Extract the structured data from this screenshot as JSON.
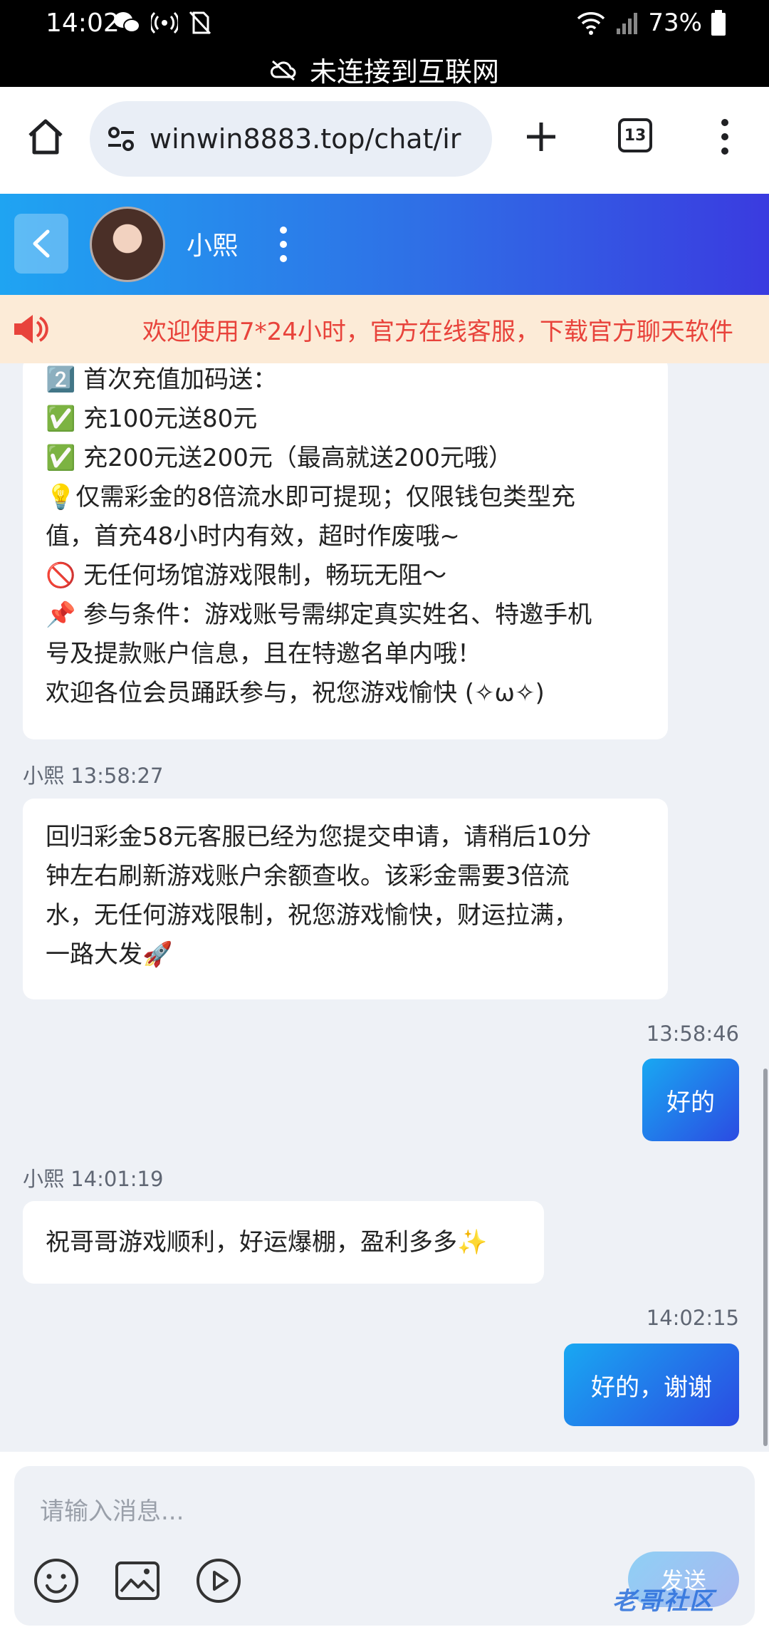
{
  "status_bar": {
    "time": "14:02",
    "battery": "73%",
    "offline_notice": "未连接到互联网"
  },
  "browser": {
    "url": "winwin8883.top/chat/ir",
    "tab_count": "13"
  },
  "chat_header": {
    "agent_name": "小熙"
  },
  "marquee": {
    "text": "欢迎使用7*24小时，官方在线客服，下载官方聊天软件"
  },
  "messages": [
    {
      "lines": [
        "2️⃣ 首次充值加码送：",
        "✅ 充100元送80元",
        "✅ 充200元送200元（最高就送200元哦）",
        "💡仅需彩金的8倍流水即可提现；仅限钱包类型充",
        "值，首充48小时内有效，超时作废哦~",
        "🚫 无任何场馆游戏限制，畅玩无阻～",
        "📌 参与条件：游戏账号需绑定真实姓名、特邀手机",
        "号及提款账户信息，且在特邀名单内哦！",
        "欢迎各位会员踊跃参与，祝您游戏愉快 (✧ω✧)"
      ]
    },
    {
      "meta": "小熙 13:58:27",
      "lines": [
        "回归彩金58元客服已经为您提交申请，请稍后10分",
        "钟左右刷新游戏账户余额查收。该彩金需要3倍流",
        "水，无任何游戏限制，祝您游戏愉快，财运拉满，",
        "一路大发🚀"
      ]
    },
    {
      "meta": "13:58:46",
      "text": "好的"
    },
    {
      "meta": "小熙 14:01:19",
      "text": "祝哥哥游戏顺利，好运爆棚，盈利多多✨"
    },
    {
      "meta": "14:02:15",
      "text": "好的，谢谢"
    }
  ],
  "composer": {
    "placeholder": "请输入消息...",
    "send_label": "发送"
  },
  "watermark": "老哥社区"
}
